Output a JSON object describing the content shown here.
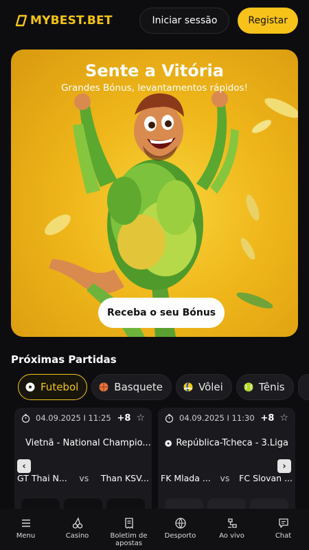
{
  "header": {
    "logo_text": "MYBEST.BET",
    "login_label": "Iniciar sessão",
    "register_label": "Registar"
  },
  "banner": {
    "title": "Sente a Vitória",
    "subtitle": "Grandes Bónus, levantamentos rápidos!",
    "cta_label": "Receba o seu Bónus"
  },
  "matches_section": {
    "title": "Próximas Partidas",
    "sports": [
      {
        "label": "Futebol",
        "icon": "soccer-ball-icon",
        "active": true
      },
      {
        "label": "Basquete",
        "icon": "basketball-icon",
        "active": false
      },
      {
        "label": "Vôlei",
        "icon": "volleyball-icon",
        "active": false
      },
      {
        "label": "Tênis",
        "icon": "tennis-ball-icon",
        "active": false
      }
    ],
    "cards": [
      {
        "datetime": "04.09.2025 I 11:25",
        "more_markets": "+8",
        "league": "Vietnã - National Champio...",
        "home": "GT Thai N...",
        "vs": "vs",
        "away": "Than KSV..."
      },
      {
        "datetime": "04.09.2025 I 11:30",
        "more_markets": "+8",
        "league": "República-Tcheca - 3.Liga",
        "home": "FK Mlada ...",
        "vs": "vs",
        "away": "FC Slovan ..."
      }
    ]
  },
  "bottom_nav": [
    {
      "label": "Menu",
      "icon": "menu-icon"
    },
    {
      "label": "Casino",
      "icon": "cherries-icon"
    },
    {
      "label": "Boletim de apostas",
      "icon": "receipt-icon"
    },
    {
      "label": "Desporto",
      "icon": "sports-ball-icon"
    },
    {
      "label": "Ao vivo",
      "icon": "live-icon"
    },
    {
      "label": "Chat",
      "icon": "chat-icon"
    }
  ],
  "colors": {
    "accent": "#f7c21a",
    "background": "#0d0d0f",
    "card": "#1a1a1e"
  }
}
